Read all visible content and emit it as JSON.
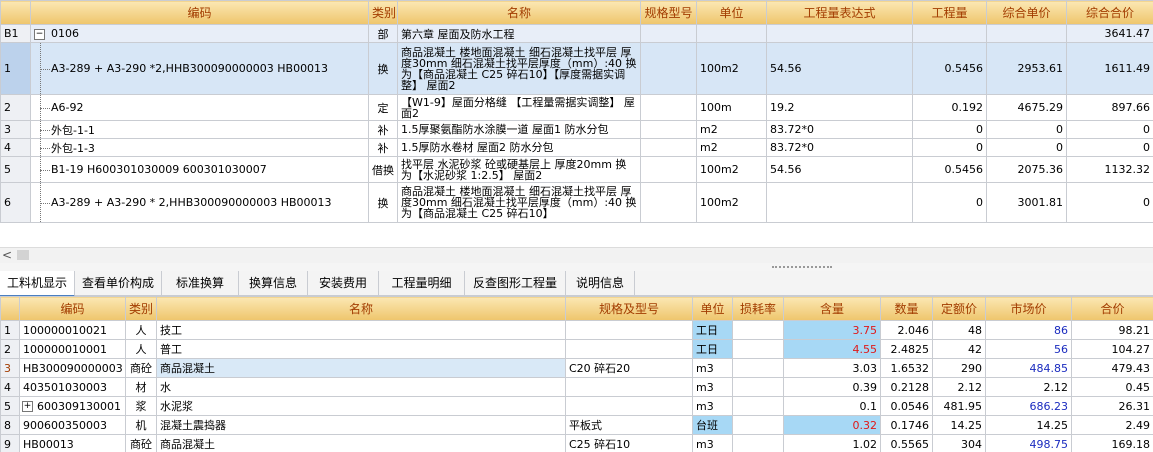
{
  "top_table": {
    "headers": [
      "编码",
      "类别",
      "名称",
      "规格型号",
      "单位",
      "工程量表达式",
      "工程量",
      "综合单价",
      "综合合价"
    ],
    "chapter": {
      "rn": "B1",
      "expand": "−",
      "code": "0106",
      "type": "部",
      "name": "第六章  屋面及防水工程",
      "total": "3641.47"
    },
    "rows": [
      {
        "rn": "1",
        "code": "A3-289 + A3-290 *2,HHB300090000003 HB00013",
        "type": "换",
        "name": "商品混凝土 楼地面混凝土 细石混凝土找平层 厚度30mm 细石混凝土找平层厚度（mm）:40 换为【商品混凝土 C25 碎石10】【厚度需据实调整】 屋面2",
        "spec": "",
        "unit": "100m2",
        "expr": "54.56",
        "qty": "0.5456",
        "price": "2953.61",
        "total": "1611.49"
      },
      {
        "rn": "2",
        "code": "A6-92",
        "type": "定",
        "name": "【W1-9】屋面分格缝 【工程量需据实调整】 屋面2",
        "spec": "",
        "unit": "100m",
        "expr": "19.2",
        "qty": "0.192",
        "price": "4675.29",
        "total": "897.66"
      },
      {
        "rn": "3",
        "code": "外包-1-1",
        "type": "补",
        "name": "1.5厚聚氨酯防水涂膜一道  屋面1 防水分包",
        "spec": "",
        "unit": "m2",
        "expr": "83.72*0",
        "qty": "0",
        "price": "0",
        "total": "0"
      },
      {
        "rn": "4",
        "code": "外包-1-3",
        "type": "补",
        "name": "1.5厚防水卷材  屋面2 防水分包",
        "spec": "",
        "unit": "m2",
        "expr": "83.72*0",
        "qty": "0",
        "price": "0",
        "total": "0"
      },
      {
        "rn": "5",
        "code": "B1-19 H600301030009 600301030007",
        "type": "借换",
        "name": "找平层 水泥砂浆 砼或硬基层上 厚度20mm 换为【水泥砂浆 1:2.5】 屋面2",
        "spec": "",
        "unit": "100m2",
        "expr": "54.56",
        "qty": "0.5456",
        "price": "2075.36",
        "total": "1132.32"
      },
      {
        "rn": "6",
        "code": "A3-289 + A3-290 * 2,HHB300090000003 HB00013",
        "type": "换",
        "name": "商品混凝土 楼地面混凝土 细石混凝土找平层 厚度30mm 细石混凝土找平层厚度（mm）:40 换为【商品混凝土 C25 碎石10】",
        "spec": "",
        "unit": "100m2",
        "expr": "",
        "qty": "0",
        "price": "3001.81",
        "total": "0"
      }
    ]
  },
  "scrollbar": {
    "left_arrow": "<"
  },
  "tabs": [
    "工料机显示",
    "查看单价构成",
    "标准换算",
    "换算信息",
    "安装费用",
    "工程量明细",
    "反查图形工程量",
    "说明信息"
  ],
  "bottom_table": {
    "headers": [
      "编码",
      "类别",
      "名称",
      "规格及型号",
      "单位",
      "损耗率",
      "含量",
      "数量",
      "定额价",
      "市场价",
      "合价"
    ],
    "rows": [
      {
        "rn": "1",
        "code": "100000010021",
        "type": "人",
        "name": "技工",
        "spec": "",
        "unit": "工日",
        "loss": "",
        "content": "3.75",
        "qty": "2.046",
        "base": "48",
        "market": "86",
        "total": "98.21"
      },
      {
        "rn": "2",
        "code": "100000010001",
        "type": "人",
        "name": "普工",
        "spec": "",
        "unit": "工日",
        "loss": "",
        "content": "4.55",
        "qty": "2.4825",
        "base": "42",
        "market": "56",
        "total": "104.27"
      },
      {
        "rn": "3",
        "code": "HB300090000003",
        "type": "商砼",
        "name": "商品混凝土",
        "spec": "C20 碎石20",
        "unit": "m3",
        "loss": "",
        "content": "3.03",
        "qty": "1.6532",
        "base": "290",
        "market": "484.85",
        "total": "479.43"
      },
      {
        "rn": "4",
        "code": "403501030003",
        "type": "材",
        "name": "水",
        "spec": "",
        "unit": "m3",
        "loss": "",
        "content": "0.39",
        "qty": "0.2128",
        "base": "2.12",
        "market": "2.12",
        "total": "0.45"
      },
      {
        "rn": "5",
        "code": "600309130001",
        "type": "浆",
        "name": "水泥浆",
        "spec": "",
        "unit": "m3",
        "loss": "",
        "content": "0.1",
        "qty": "0.0546",
        "base": "481.95",
        "market": "686.23",
        "total": "26.31"
      },
      {
        "rn": "8",
        "code": "900600350003",
        "type": "机",
        "name": "混凝土震捣器",
        "spec": "平板式",
        "unit": "台班",
        "loss": "",
        "content": "0.32",
        "qty": "0.1746",
        "base": "14.25",
        "market": "14.25",
        "total": "2.49"
      },
      {
        "rn": "9",
        "code": "HB00013",
        "type": "商砼",
        "name": "商品混凝土",
        "spec": "C25 碎石10",
        "unit": "m3",
        "loss": "",
        "content": "1.02",
        "qty": "0.5565",
        "base": "304",
        "market": "498.75",
        "total": "169.18"
      }
    ]
  }
}
